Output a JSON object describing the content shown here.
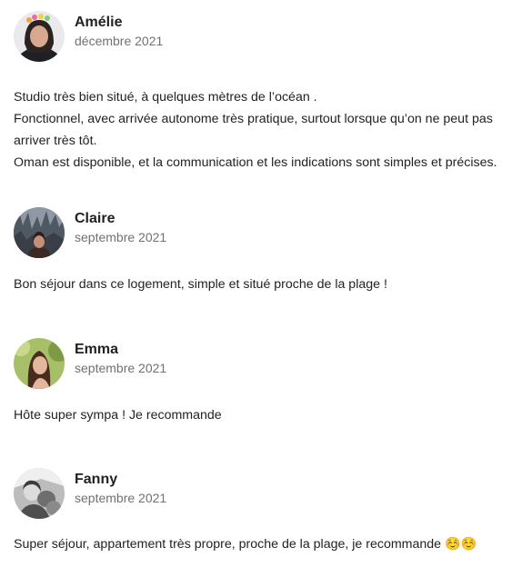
{
  "reviews": [
    {
      "name": "Amélie",
      "date": "décembre 2021",
      "avatar_icon": "avatar-photo-amelie",
      "lines": [
        "Studio très bien situé, à quelques mètres de l’océan .",
        "Fonctionnel, avec arrivée autonome très pratique, surtout lorsque qu’on ne peut pas",
        "arriver très tôt.",
        "Oman est disponible, et la communication et les indications sont simples et précises."
      ]
    },
    {
      "name": "Claire",
      "date": "septembre 2021",
      "avatar_icon": "avatar-photo-claire",
      "lines": [
        "Bon séjour dans ce logement, simple et situé proche de la plage !"
      ]
    },
    {
      "name": "Emma",
      "date": "septembre 2021",
      "avatar_icon": "avatar-photo-emma",
      "lines": [
        "Hôte super sympa ! Je recommande"
      ]
    },
    {
      "name": "Fanny",
      "date": "septembre 2021",
      "avatar_icon": "avatar-photo-fanny",
      "lines": [
        "Super séjour, appartement très propre, proche de la plage, je recommande ☺️☺️"
      ]
    }
  ],
  "colors": {
    "name": "#222222",
    "date": "#717171",
    "text": "#222222"
  }
}
